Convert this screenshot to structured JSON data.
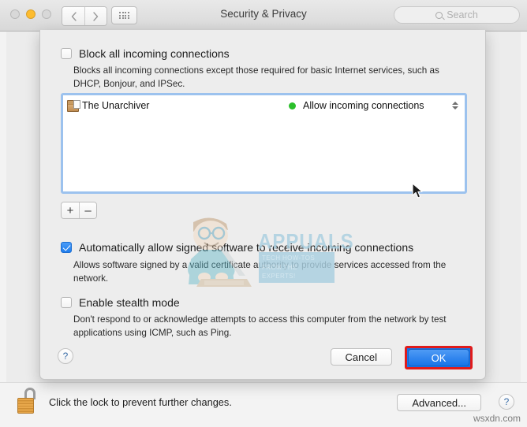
{
  "window": {
    "title": "Security & Privacy",
    "traffic_lights": [
      "close",
      "minimize",
      "zoom"
    ],
    "nav_back_icon": "chevron-left-icon",
    "nav_forward_icon": "chevron-right-icon",
    "show_all_icon": "grid-icon",
    "search": {
      "placeholder": "Search",
      "value": "",
      "icon": "search-icon"
    }
  },
  "sheet": {
    "block_all": {
      "label": "Block all incoming connections",
      "checked": false,
      "description": "Blocks all incoming connections except those required for basic Internet services,  such as DHCP, Bonjour, and IPSec."
    },
    "app_list": {
      "rows": [
        {
          "icon": "unarchiver-app-icon",
          "name": "The Unarchiver",
          "status_dot_color": "#2bbf2b",
          "status": "Allow incoming connections",
          "stepper_icon": "up-down-chevron-icon"
        }
      ]
    },
    "list_controls": {
      "add_label": "+",
      "remove_label": "–"
    },
    "auto_allow": {
      "label": "Automatically allow signed software to receive incoming connections",
      "checked": true,
      "description": "Allows software signed by a valid certificate authority to provide services accessed from the network."
    },
    "stealth": {
      "label": "Enable stealth mode",
      "checked": false,
      "description": "Don't respond to or acknowledge attempts to access this computer from the network by test applications using ICMP, such as Ping."
    },
    "footer": {
      "help_label": "?",
      "cancel_label": "Cancel",
      "ok_label": "OK",
      "ok_highlight_color": "#e01b1b"
    }
  },
  "bottom_bar": {
    "lock_icon": "unlocked-padlock-icon",
    "lock_text": "Click the lock to prevent further changes.",
    "advanced_label": "Advanced...",
    "help_label": "?"
  },
  "watermarks": {
    "brand": "APPUALS",
    "tagline": "TECH HOW-TOS FROM\nTHE EXPERTS!",
    "site": "wsxdn.com"
  },
  "colors": {
    "accent_blue": "#1874e8",
    "focus_ring": "#9cc2ee",
    "status_green": "#2bbf2b",
    "lock_gold": "#e8a84c"
  }
}
